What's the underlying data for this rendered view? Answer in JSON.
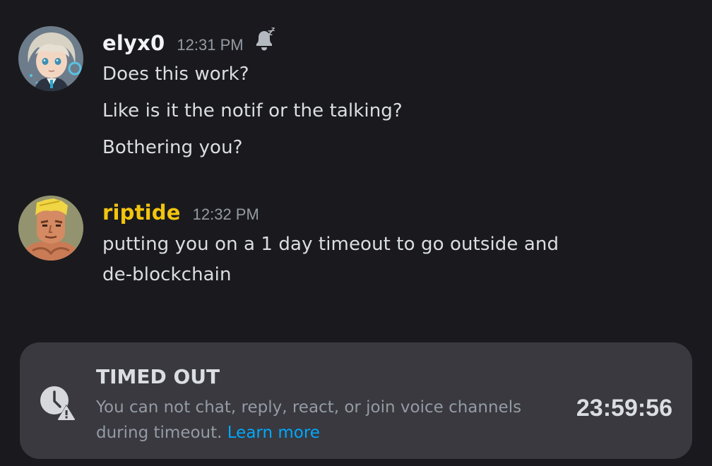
{
  "messages": [
    {
      "username": "elyx0",
      "timestamp": "12:31 PM",
      "status_icon": "bell-sleep-icon",
      "lines": [
        "Does this work?",
        "Like is it the notif or the talking?",
        "Bothering you?"
      ]
    },
    {
      "username": "riptide",
      "username_color": "#f1c40f",
      "timestamp": "12:32 PM",
      "lines": [
        "putting you on a 1 day timeout to go outside and",
        "de-blockchain"
      ]
    }
  ],
  "timeout": {
    "title": "TIMED OUT",
    "description": "You can not chat, reply, react, or join voice channels during timeout.",
    "learn_more": "Learn more",
    "countdown": "23:59:56",
    "icon": "clock-warning-icon"
  },
  "colors": {
    "background": "#1a1a1e",
    "panel": "#39393f",
    "link": "#00a8fc",
    "username_gold": "#f1c40f",
    "muted": "#949ba4"
  }
}
